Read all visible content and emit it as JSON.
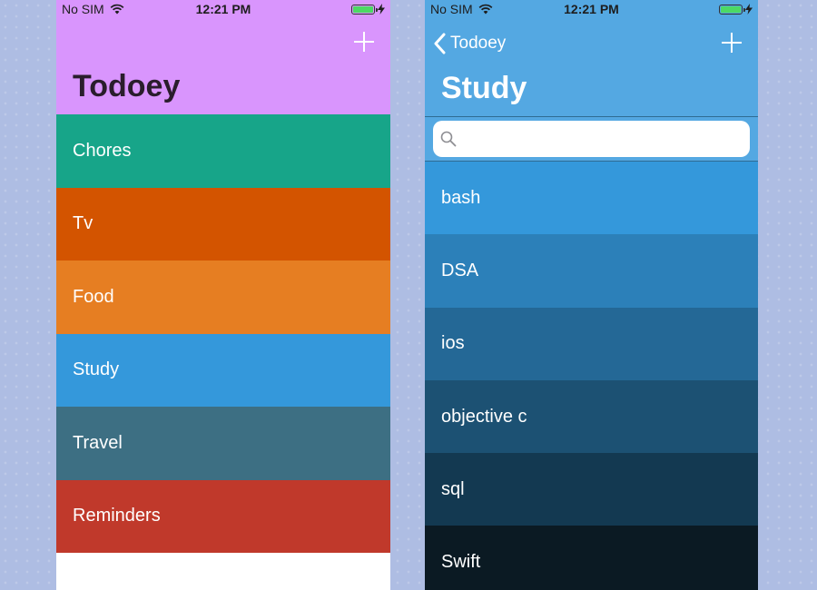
{
  "left": {
    "status": {
      "carrier": "No SIM",
      "time": "12:21 PM"
    },
    "title": "Todoey",
    "header_color": "#d995fd",
    "categories": [
      {
        "label": "Chores",
        "color": "#17a589"
      },
      {
        "label": "Tv",
        "color": "#d35400"
      },
      {
        "label": "Food",
        "color": "#e67e22"
      },
      {
        "label": "Study",
        "color": "#3498db"
      },
      {
        "label": "Travel",
        "color": "#3d6f83"
      },
      {
        "label": "Reminders",
        "color": "#c0392b"
      }
    ]
  },
  "right": {
    "status": {
      "carrier": "No SIM",
      "time": "12:21 PM"
    },
    "back_label": "Todoey",
    "title": "Study",
    "header_color": "#54a8e2",
    "search": {
      "placeholder": "",
      "value": ""
    },
    "items": [
      {
        "label": "bash",
        "color": "#3498db"
      },
      {
        "label": "DSA",
        "color": "#2c80b9"
      },
      {
        "label": "ios",
        "color": "#246896"
      },
      {
        "label": "objective c",
        "color": "#1c5173"
      },
      {
        "label": "sql",
        "color": "#133951"
      },
      {
        "label": "Swift",
        "color": "#0b1a23"
      }
    ]
  }
}
